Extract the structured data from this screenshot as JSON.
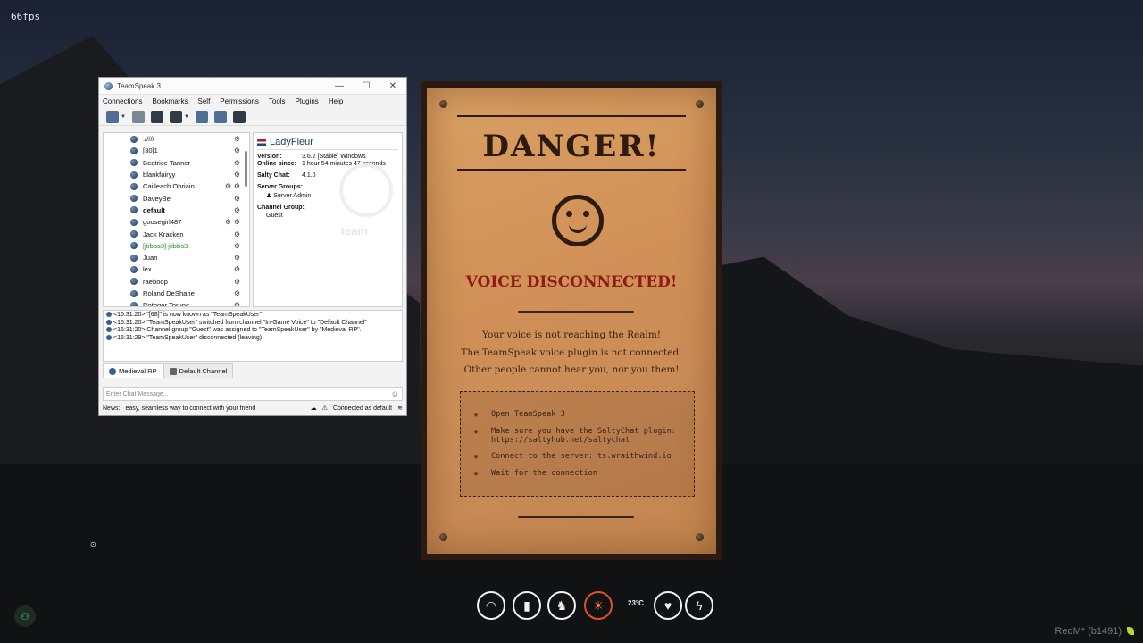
{
  "hud_top": {
    "fps": "66fps"
  },
  "teamspeak": {
    "window_title": "TeamSpeak 3",
    "window_controls": {
      "minimize": "—",
      "maximize": "☐",
      "close": "✕"
    },
    "menu": [
      "Connections",
      "Bookmarks",
      "Self",
      "Permissions",
      "Tools",
      "Plugins",
      "Help"
    ],
    "toolbar_icons": [
      "connect-icon",
      "disconnect-icon",
      "mute-microphone-icon",
      "mute-speakers-icon",
      "away-icon",
      "contacts-icon",
      "hotkey-icon"
    ],
    "channel_tree": [
      {
        "name": "./////",
        "bold": false,
        "color": "#111111",
        "icons": 1
      },
      {
        "name": "[30]1",
        "bold": false,
        "color": "#111111",
        "icons": 1
      },
      {
        "name": "Beatrice Tanner",
        "bold": false,
        "color": "#111111",
        "icons": 1
      },
      {
        "name": "blankfairyy",
        "bold": false,
        "color": "#111111",
        "icons": 1
      },
      {
        "name": "Cailleach Obriain",
        "bold": false,
        "color": "#111111",
        "icons": 2
      },
      {
        "name": "DaveyBe",
        "bold": false,
        "color": "#111111",
        "icons": 1
      },
      {
        "name": "default",
        "bold": true,
        "color": "#111111",
        "icons": 1
      },
      {
        "name": "goosegirl487",
        "bold": false,
        "color": "#111111",
        "icons": 2
      },
      {
        "name": "Jack Kracken",
        "bold": false,
        "color": "#111111",
        "icons": 1
      },
      {
        "name": "[jtibbs3] jtibbs3",
        "bold": false,
        "color": "#2e8b2e",
        "icons": 1
      },
      {
        "name": "Juan",
        "bold": false,
        "color": "#111111",
        "icons": 1
      },
      {
        "name": "lex",
        "bold": false,
        "color": "#111111",
        "icons": 1
      },
      {
        "name": "raeboop",
        "bold": false,
        "color": "#111111",
        "icons": 1
      },
      {
        "name": "Roland DeShane",
        "bold": false,
        "color": "#111111",
        "icons": 1
      },
      {
        "name": "Rothgar Torune",
        "bold": false,
        "color": "#111111",
        "icons": 1
      }
    ],
    "info": {
      "username": "LadyFleur",
      "version_label": "Version:",
      "version_value": "3.6.2 [Stable] Windows",
      "online_label": "Online since:",
      "online_value": "1 hour 54 minutes 47 seconds",
      "salty_label": "Salty Chat:",
      "salty_value": "4.1.0",
      "server_groups_label": "Server Groups:",
      "server_group": "Server Admin",
      "channel_group_label": "Channel Group:",
      "channel_group": "Guest",
      "watermark": "team"
    },
    "chat_log": [
      "<16:31:20> \"[68]\" is now known as \"TeamSpeakUser\"",
      "<16:31:20> \"TeamSpeakUser\" switched from channel \"In-Game Voice\" to \"Default Channel\"",
      "<16:31:20> Channel group \"Guest\" was assigned to \"TeamSpeakUser\" by \"Medieval RP\".",
      "<16:31:29> \"TeamSpeakUser\" disconnected (leaving)"
    ],
    "tabs": [
      "Medieval RP",
      "Default Channel"
    ],
    "chat_placeholder": "Enter Chat Message...",
    "status": {
      "news_label": "News:",
      "news_text": "easy, seamless way to connect with your friend",
      "connection": "Connected as default"
    }
  },
  "poster": {
    "title": "DANGER!",
    "subtitle": "VOICE DISCONNECTED!",
    "message_lines": [
      "Your voice is not reaching the Realm!",
      "The TeamSpeak voice plugin is not connected.",
      "Other people cannot hear you, nor you them!"
    ],
    "steps": [
      "Open TeamSpeak 3",
      "Make sure you have the SaltyChat plugin: https://saltyhub.net/saltychat",
      "Connect to the server: ts.wraithwind.io",
      "Wait for the connection"
    ],
    "colors": {
      "paper": "#d19158",
      "ink": "#2d1b12",
      "accent": "#8c1c16"
    }
  },
  "hud": {
    "icons": [
      "voice-icon",
      "stamina-icon",
      "horse-icon",
      "sun-icon",
      "health-icon",
      "deadeye-icon"
    ],
    "temperature": "23°C"
  },
  "footer": {
    "build": "RedM* (b1491)"
  }
}
